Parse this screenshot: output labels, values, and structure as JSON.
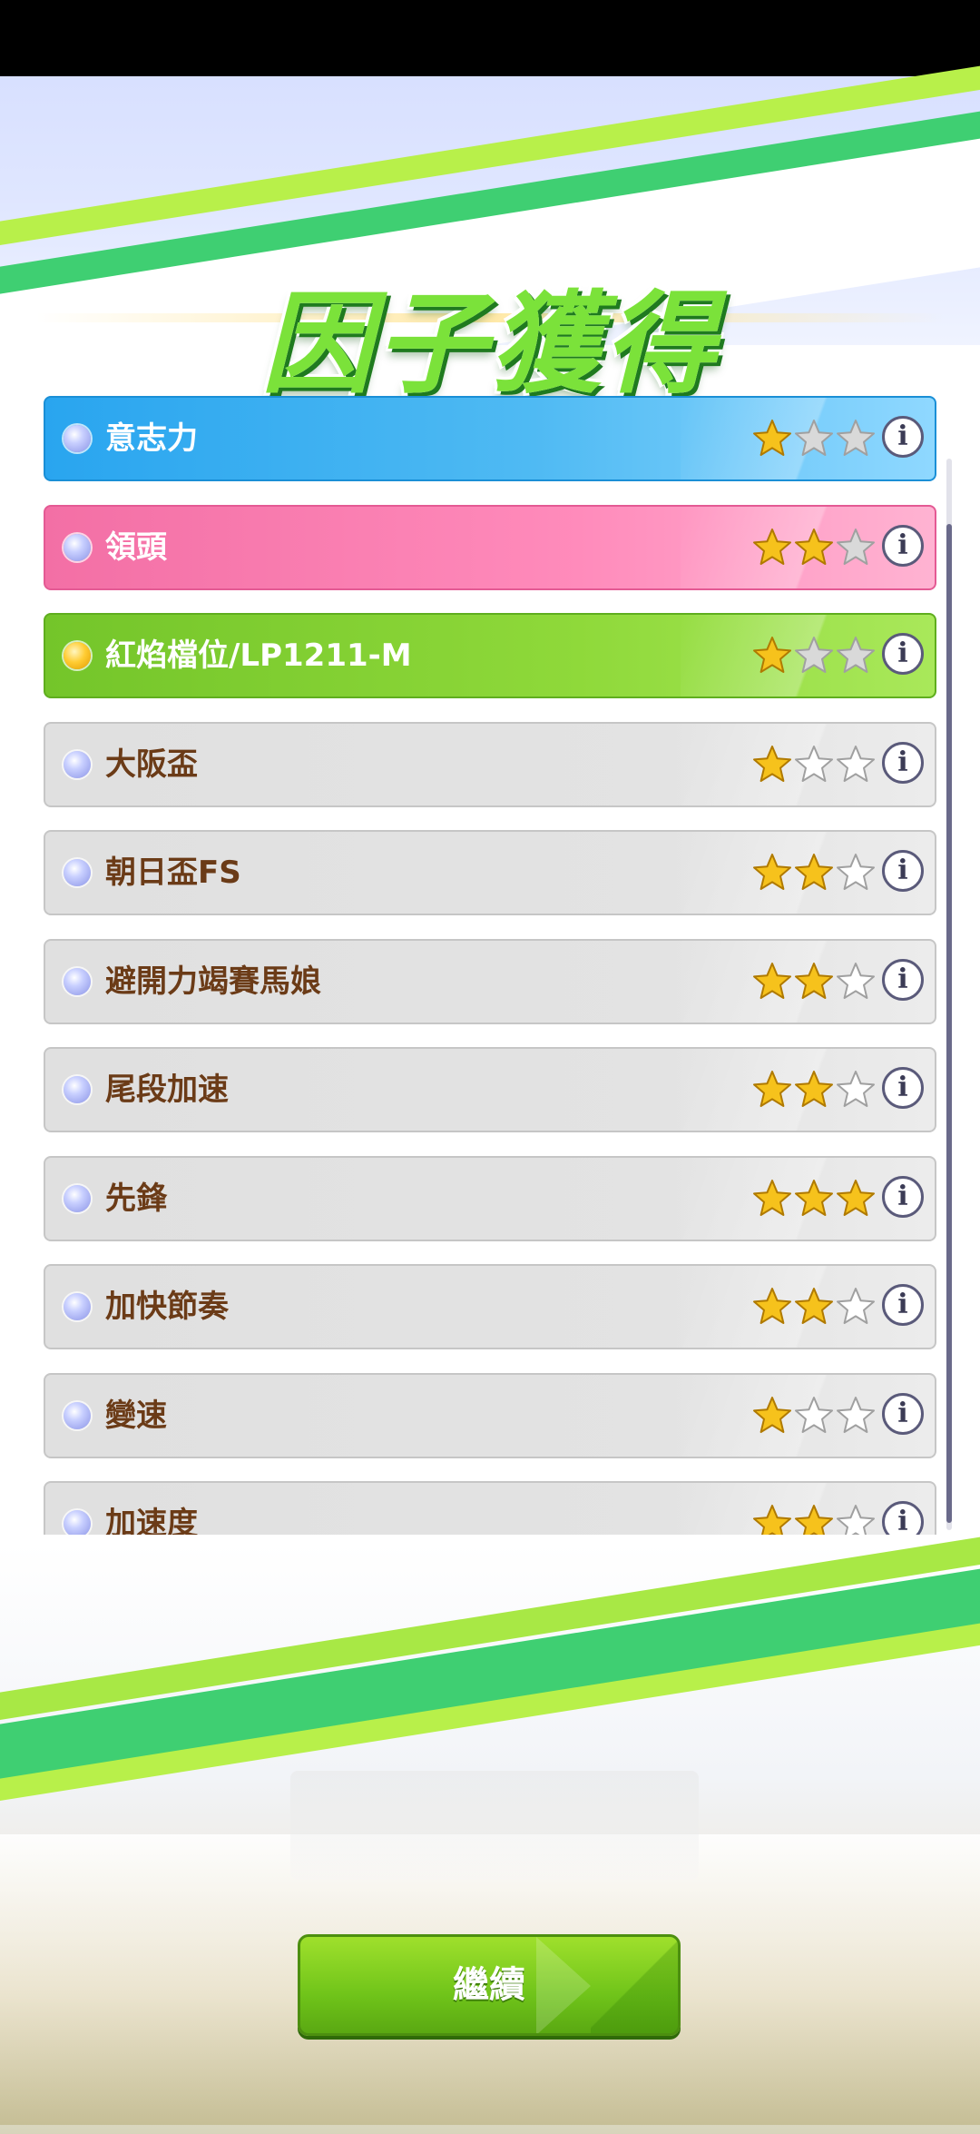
{
  "title": "因子獲得",
  "factors": [
    {
      "label": "意志力",
      "stars": 1,
      "style": "blue"
    },
    {
      "label": "領頭",
      "stars": 2,
      "style": "pink"
    },
    {
      "label": "紅焰檔位/LP1211-M",
      "stars": 1,
      "style": "green"
    },
    {
      "label": "大阪盃",
      "stars": 1,
      "style": "gray"
    },
    {
      "label": "朝日盃FS",
      "stars": 2,
      "style": "gray"
    },
    {
      "label": "避開力竭賽馬娘",
      "stars": 2,
      "style": "gray"
    },
    {
      "label": "尾段加速",
      "stars": 2,
      "style": "gray"
    },
    {
      "label": "先鋒",
      "stars": 3,
      "style": "gray"
    },
    {
      "label": "加快節奏",
      "stars": 2,
      "style": "gray"
    },
    {
      "label": "變速",
      "stars": 1,
      "style": "gray"
    },
    {
      "label": "加速度",
      "stars": 2,
      "style": "gray"
    }
  ],
  "info_icon": "i",
  "continue_label": "繼續",
  "colors": {
    "star_filled": "#f6c21c",
    "star_empty_colored_row": "#d9d9d9",
    "star_empty_gray_row": "#ffffff"
  }
}
